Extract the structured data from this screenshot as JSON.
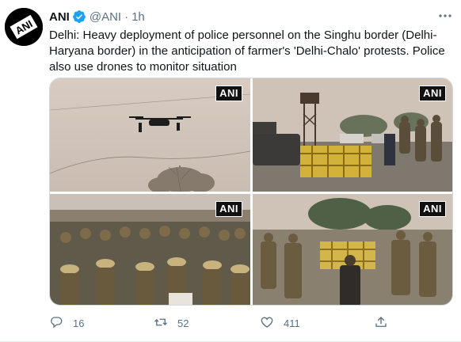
{
  "tweet": {
    "display_name": "ANI",
    "handle": "@ANI",
    "separator": "·",
    "time": "1h",
    "text": "Delhi: Heavy deployment of police personnel on the Singhu border (Delhi-Haryana border) in the anticipation of farmer's 'Delhi-Chalo' protests. Police also use drones to monitor situation",
    "avatar_logo_text": "ANI",
    "icons": {
      "verified": "verified-badge-icon",
      "more": "more-options-icon",
      "reply": "reply-icon",
      "retweet": "retweet-icon",
      "like": "like-heart-icon",
      "share": "share-icon"
    },
    "colors": {
      "verified": "#1da1f2",
      "secondary_text": "#5b7083",
      "text": "#0f1419"
    }
  },
  "media": {
    "watermark": "ANI",
    "photos": [
      {
        "subject": "drone-photo"
      },
      {
        "subject": "barricade-tower-photo"
      },
      {
        "subject": "police-crowd-photo"
      },
      {
        "subject": "police-barricade-photo"
      }
    ]
  },
  "actions": {
    "replies": "16",
    "retweets": "52",
    "likes": "411"
  }
}
